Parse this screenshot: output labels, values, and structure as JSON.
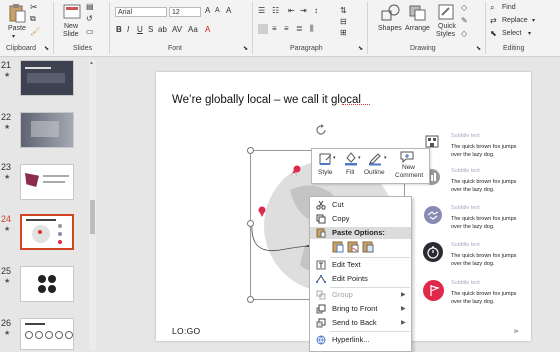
{
  "ribbon": {
    "clipboard": {
      "paste": "Paste",
      "label": "Clipboard"
    },
    "slides": {
      "new_slide_1": "New",
      "new_slide_2": "Slide",
      "label": "Slides"
    },
    "font": {
      "family": "Arial",
      "size": "12",
      "label": "Font"
    },
    "paragraph": {
      "label": "Paragraph"
    },
    "drawing": {
      "shapes": "Shapes",
      "arrange": "Arrange",
      "quick_styles_1": "Quick",
      "quick_styles_2": "Styles",
      "label": "Drawing"
    },
    "editing": {
      "find": "Find",
      "replace": "Replace",
      "select": "Select",
      "label": "Editing"
    }
  },
  "slides_pane": [
    {
      "num": "21",
      "star": "★"
    },
    {
      "num": "22",
      "star": "★"
    },
    {
      "num": "23",
      "star": "★"
    },
    {
      "num": "24",
      "star": "★"
    },
    {
      "num": "25",
      "star": "★"
    },
    {
      "num": "26",
      "star": "★"
    }
  ],
  "slide": {
    "title": "We’re globally local – we call it glocal",
    "logo": "LO:GO",
    "subtitles": [
      {
        "title": "Subtitle text",
        "desc": "The quick brown fox jumps over the lazy dog."
      },
      {
        "title": "Subtitle text",
        "desc": "The quick brown fox jumps over the lazy dog."
      },
      {
        "title": "Subtitle text",
        "desc": "The quick brown fox jumps over the lazy dog."
      },
      {
        "title": "Subtitle text",
        "desc": "The quick brown fox jumps over the lazy dog."
      },
      {
        "title": "Subtitle text",
        "desc": "The quick brown fox jumps over the lazy dog."
      }
    ]
  },
  "mini_toolbar": {
    "style": "Style",
    "fill": "Fill",
    "outline": "Outline",
    "new_comment_1": "New",
    "new_comment_2": "Comment"
  },
  "context_menu": {
    "cut": "Cut",
    "copy": "Copy",
    "paste_options": "Paste Options:",
    "edit_text": "Edit Text",
    "edit_points": "Edit Points",
    "group": "Group",
    "bring_to_front": "Bring to Front",
    "send_to_back": "Send to Back",
    "hyperlink": "Hyperlink..."
  },
  "colors": {
    "accent": "#d04423",
    "menu_highlight": "#dcdcdc",
    "icon_purple": "#8b89b5",
    "icon_dark": "#2b2b33",
    "icon_red": "#e0294a"
  }
}
